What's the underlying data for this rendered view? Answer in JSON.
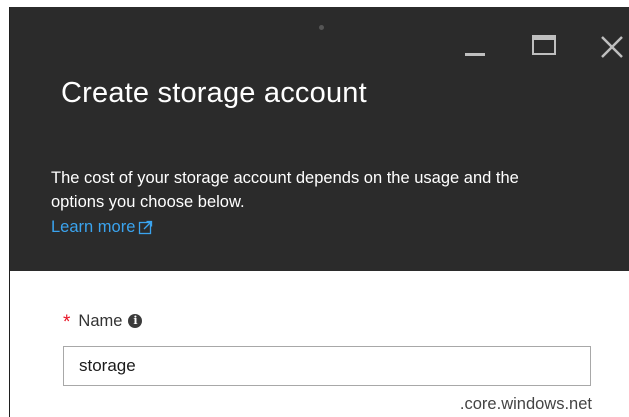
{
  "window": {
    "title": "Create storage account",
    "controls": {
      "minimize_icon": "minimize-icon",
      "maximize_icon": "maximize-icon",
      "close_icon": "close-icon"
    }
  },
  "header": {
    "description": "The cost of your storage account depends on the usage and the options you choose below.",
    "learn_more": "Learn more",
    "learn_more_icon": "external-link-icon"
  },
  "form": {
    "name": {
      "required_marker": "*",
      "label": "Name",
      "info_icon": "info-icon",
      "value": "storage",
      "suffix": ".core.windows.net"
    }
  },
  "colors": {
    "header_bg": "#2b2b2b",
    "link": "#3aa3ee",
    "required": "#e81123"
  }
}
